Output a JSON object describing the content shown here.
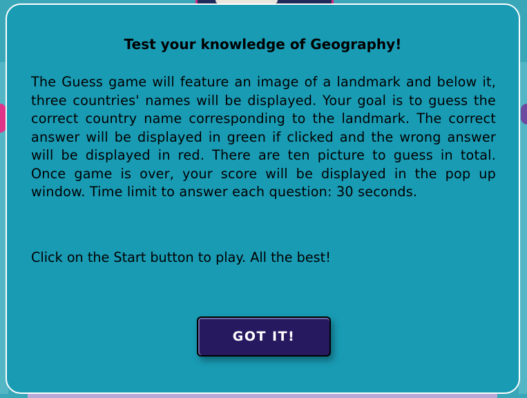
{
  "modal": {
    "title": "Test your knowledge of Geography!",
    "description": "The Guess game will feature an image of a landmark and below it, three countries' names will be displayed. Your goal is to guess the correct country name corresponding to the landmark. The correct answer will be displayed in green if clicked and the wrong answer will be displayed in red. There are ten picture to guess in total. Once game is over, your score will be displayed in the pop up window. Time limit to answer each question: 30 seconds.",
    "call_to_action": "Click on the Start button to play. All the best!",
    "button_label": "GOT IT!"
  },
  "colors": {
    "modal_background": "#199bb4",
    "modal_border": "#ffffff",
    "button_background": "#271960",
    "button_text": "#ffffff",
    "page_background": "#3aa7b9"
  }
}
